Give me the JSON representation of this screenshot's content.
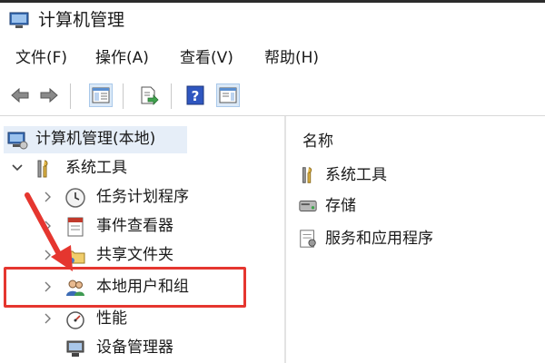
{
  "window": {
    "title": "计算机管理"
  },
  "menu": [
    "文件(F)",
    "操作(A)",
    "查看(V)",
    "帮助(H)"
  ],
  "toolbar": {
    "buttons": [
      "back-icon",
      "forward-icon",
      "show-hide-tree-icon",
      "export-list-icon",
      "help-icon",
      "action-pane-icon"
    ]
  },
  "tree": {
    "root": "计算机管理(本地)",
    "system_tools": "系统工具",
    "children": [
      "任务计划程序",
      "事件查看器",
      "共享文件夹",
      "本地用户和组",
      "性能",
      "设备管理器"
    ]
  },
  "right_pane": {
    "column_header": "名称",
    "items": [
      "系统工具",
      "存储",
      "服务和应用程序"
    ]
  },
  "colors": {
    "highlight_red": "#e5362f",
    "selection_bg": "#e6eef8"
  }
}
